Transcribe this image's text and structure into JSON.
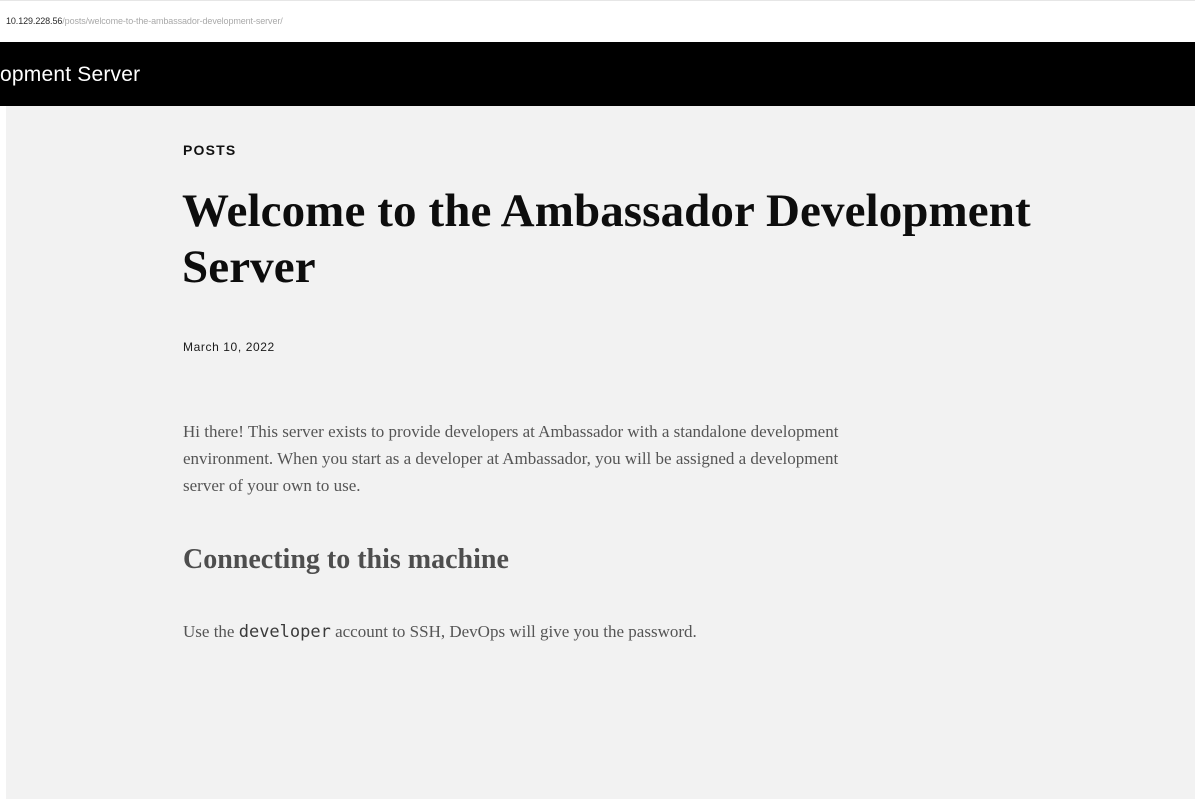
{
  "browser": {
    "url_host": "10.129.228.56",
    "url_path": "/posts/welcome-to-the-ambassador-development-server/"
  },
  "site": {
    "title": "opment Server"
  },
  "post": {
    "category": "POSTS",
    "title": "Welcome to the Ambassador Development Server",
    "date": "March 10, 2022",
    "paragraph_1": "Hi there! This server exists to provide developers at Ambassador with a standalone development environment. When you start as a developer at Ambassador, you will be assigned a development server of your own to use.",
    "section_heading": "Connecting to this machine",
    "paragraph_2_before": "Use the ",
    "paragraph_2_code": "developer",
    "paragraph_2_after": " account to SSH, DevOps will give you the password."
  },
  "colors": {
    "header_bg": "#000000",
    "content_bg": "#f2f2f2",
    "body_text": "#555555"
  }
}
